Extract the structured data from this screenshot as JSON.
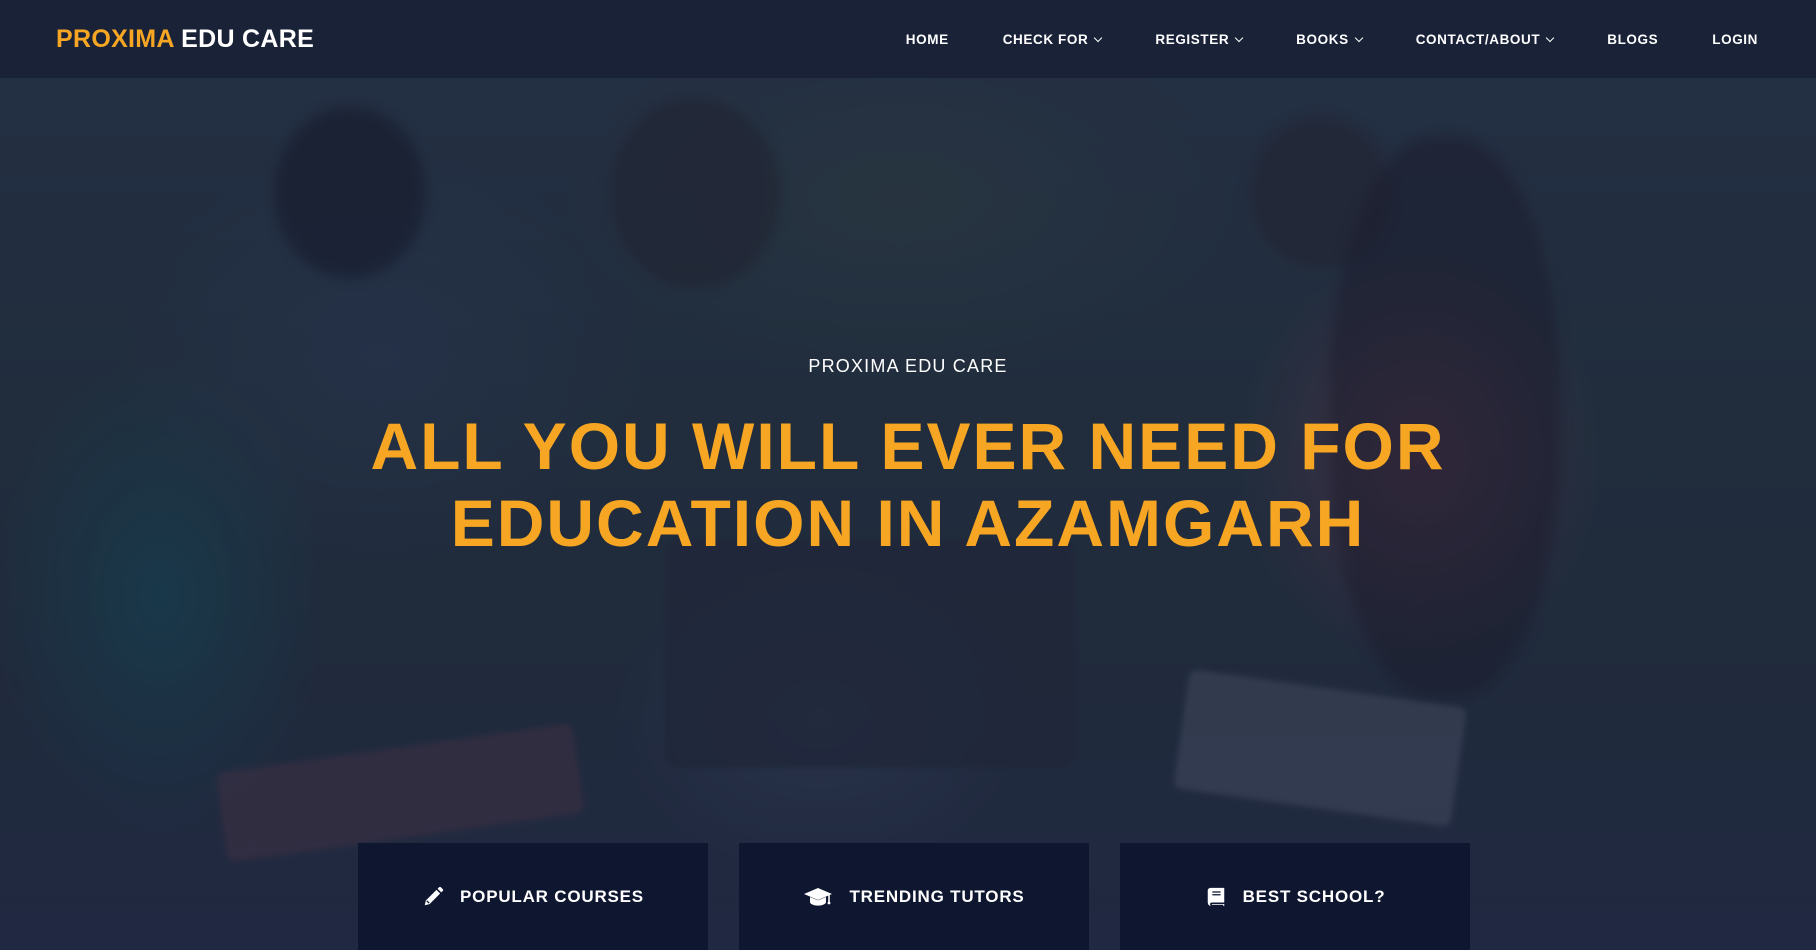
{
  "header": {
    "brand_part1": "PROXIMA",
    "brand_part2": "EDU CARE",
    "nav": [
      {
        "label": "HOME",
        "dropdown": false
      },
      {
        "label": "CHECK FOR",
        "dropdown": true
      },
      {
        "label": "REGISTER",
        "dropdown": true
      },
      {
        "label": "BOOKS",
        "dropdown": true
      },
      {
        "label": "CONTACT/ABOUT",
        "dropdown": true
      },
      {
        "label": "BLOGS",
        "dropdown": false
      },
      {
        "label": "LOGIN",
        "dropdown": false
      }
    ]
  },
  "hero": {
    "eyebrow": "PROXIMA EDU CARE",
    "headline_line1": "ALL YOU WILL EVER NEED FOR",
    "headline_line2": "EDUCATION IN AZAMGARH"
  },
  "cards": [
    {
      "label": "POPULAR COURSES",
      "icon": "pencil-icon"
    },
    {
      "label": "TRENDING TUTORS",
      "icon": "graduation-cap-icon"
    },
    {
      "label": "BEST SCHOOL?",
      "icon": "book-icon"
    }
  ],
  "colors": {
    "accent": "#f6a623",
    "navbar_bg": "#1a2238",
    "card_bg": "#0f1630",
    "text": "#ffffff"
  }
}
